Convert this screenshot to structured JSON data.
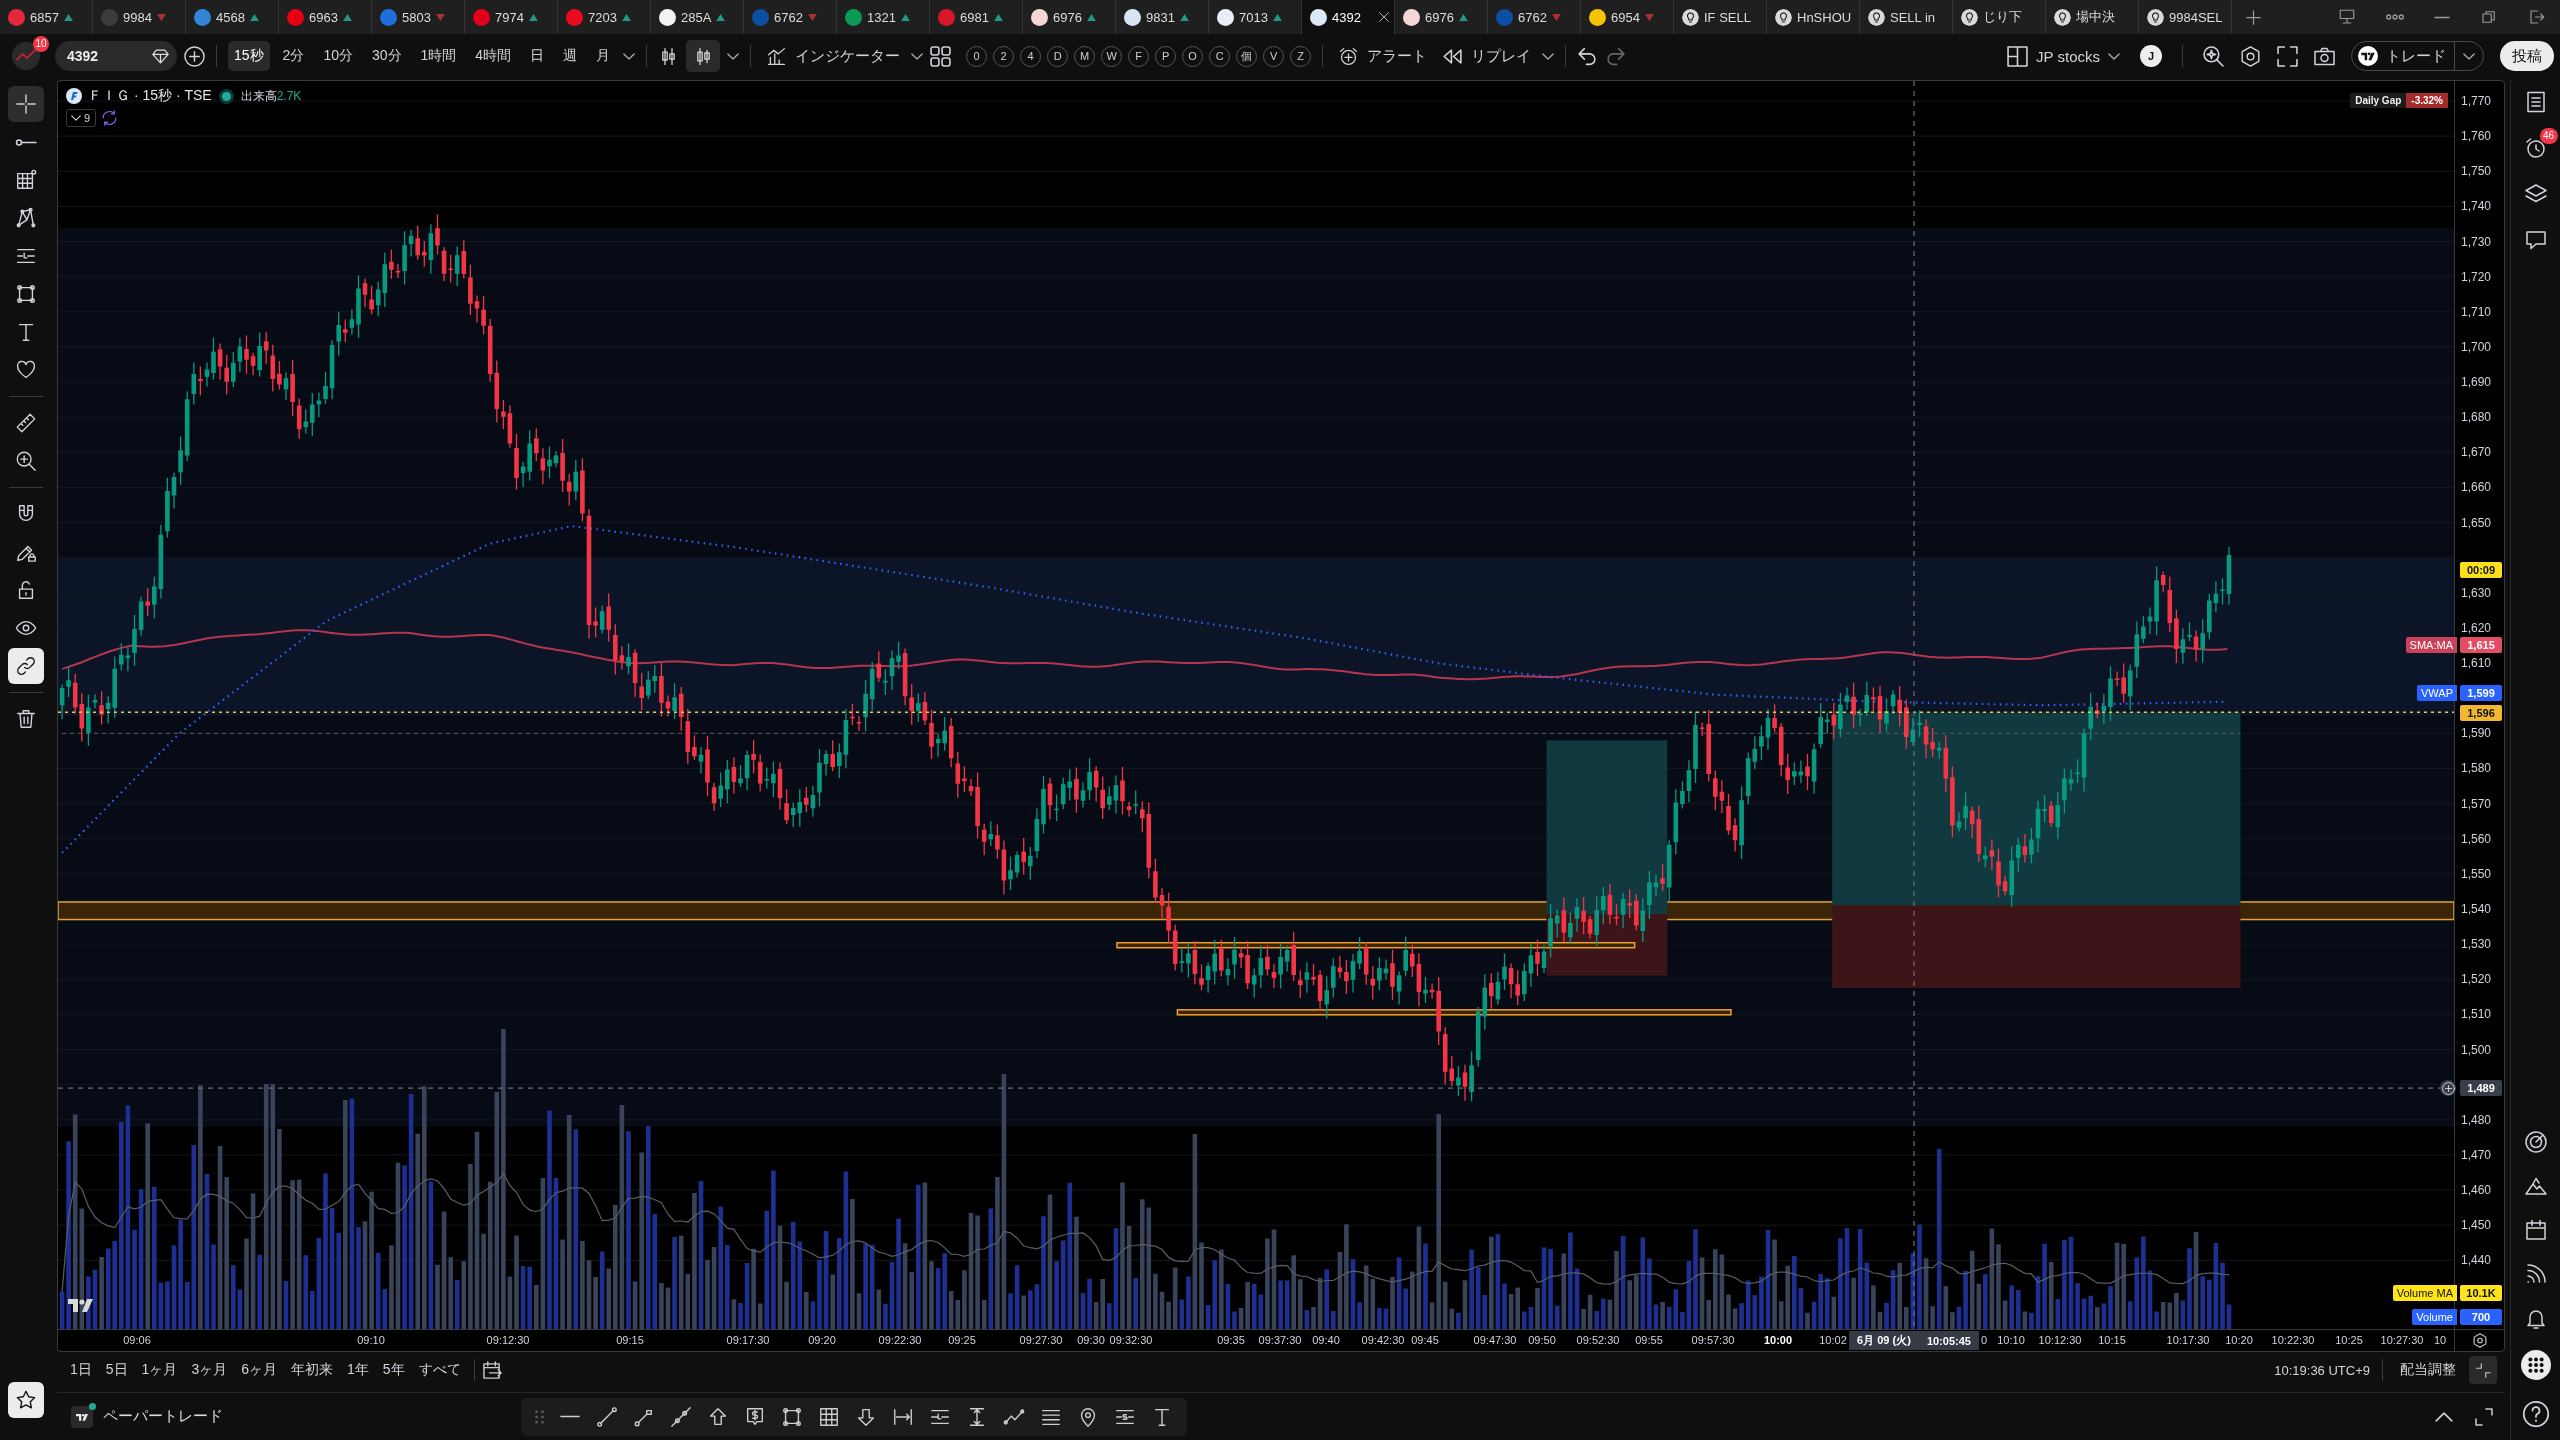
{
  "tabs": [
    {
      "kind": "symbol",
      "label": "6857",
      "color": "#e3283c",
      "rising": true,
      "selected": false
    },
    {
      "kind": "symbol",
      "label": "9984",
      "color": "#3c3c3c",
      "rising": false,
      "selected": false
    },
    {
      "kind": "symbol",
      "label": "4568",
      "color": "#2f86d6",
      "rising": true,
      "selected": false
    },
    {
      "kind": "symbol",
      "label": "6963",
      "color": "#e60012",
      "rising": true,
      "selected": false
    },
    {
      "kind": "symbol",
      "label": "5803",
      "color": "#1e6fd9",
      "rising": false,
      "selected": false
    },
    {
      "kind": "symbol",
      "label": "7974",
      "color": "#e4001b",
      "rising": true,
      "selected": false
    },
    {
      "kind": "symbol",
      "label": "7203",
      "color": "#eb0a1e",
      "rising": true,
      "selected": false
    },
    {
      "kind": "symbol",
      "label": "285A",
      "color": "#f2f2f2",
      "rising": true,
      "selected": false
    },
    {
      "kind": "symbol",
      "label": "6762",
      "color": "#0b4ea2",
      "rising": false,
      "selected": false
    },
    {
      "kind": "symbol",
      "label": "1321",
      "color": "#0a9a55",
      "rising": true,
      "selected": false
    },
    {
      "kind": "symbol",
      "label": "6981",
      "color": "#d7182a",
      "rising": true,
      "selected": false
    },
    {
      "kind": "symbol",
      "label": "6976",
      "color": "#f4d6d8",
      "rising": true,
      "selected": false
    },
    {
      "kind": "symbol",
      "label": "9831",
      "color": "#d8e4f4",
      "rising": true,
      "selected": false
    },
    {
      "kind": "symbol",
      "label": "7013",
      "color": "#e8eef8",
      "rising": true,
      "selected": false
    },
    {
      "kind": "symbol",
      "label": "4392",
      "color": "#dce8f6",
      "selected": true
    },
    {
      "kind": "symbol",
      "label": "6976",
      "color": "#f4d6d8",
      "rising": true,
      "selected": false
    },
    {
      "kind": "symbol",
      "label": "6762",
      "color": "#0b4ea2",
      "rising": false,
      "selected": false
    },
    {
      "kind": "symbol",
      "label": "6954",
      "color": "#f5c400",
      "rising": false,
      "selected": false
    },
    {
      "kind": "idea",
      "label": "IF SELL",
      "selected": false
    },
    {
      "kind": "idea",
      "label": "HnSHOU",
      "selected": false
    },
    {
      "kind": "idea",
      "label": "SELL in",
      "selected": false
    },
    {
      "kind": "idea",
      "label": "じり下",
      "selected": false
    },
    {
      "kind": "idea",
      "label": "場中決",
      "selected": false
    },
    {
      "kind": "idea",
      "label": "9984SEL",
      "selected": false
    }
  ],
  "toolbar": {
    "notifications": "10",
    "symbol": "4392",
    "intervals": [
      {
        "label": "15秒",
        "selected": true
      },
      {
        "label": "2分",
        "selected": false
      },
      {
        "label": "10分",
        "selected": false
      },
      {
        "label": "30分",
        "selected": false
      },
      {
        "label": "1時間",
        "selected": false
      },
      {
        "label": "4時間",
        "selected": false
      },
      {
        "label": "日",
        "selected": false
      },
      {
        "label": "週",
        "selected": false
      },
      {
        "label": "月",
        "selected": false
      }
    ],
    "indicators": "インジケーター",
    "quick_buttons": [
      "0",
      "2",
      "4",
      "D",
      "M",
      "W",
      "F",
      "P",
      "O",
      "C",
      "個",
      "V",
      "Z"
    ],
    "alert": "アラート",
    "replay": "リプレイ",
    "layout": "JP stocks",
    "user_initial": "J",
    "trade": "トレード",
    "publish": "投稿"
  },
  "left_toolbar": {
    "tools": [
      {
        "selected": true
      },
      {
        "selected": false
      },
      {
        "selected": false
      },
      {
        "selected": false
      },
      {
        "selected": false
      },
      {
        "selected": false
      },
      {
        "selected": false
      },
      {
        "selected": false
      },
      {
        "selected": false
      },
      {
        "selected": false
      }
    ],
    "toggles": [
      {
        "on": false
      },
      {
        "on": false
      },
      {
        "on": false
      },
      {
        "on": false
      },
      {
        "on": true
      }
    ]
  },
  "chart": {
    "title": "ＦＩＧ · 15秒 · TSE",
    "volume_label": "出来高",
    "volume_value": "2.7K",
    "indicator_count": "9",
    "daily_gap": {
      "label": "Daily Gap",
      "value": "-3.32%"
    },
    "price_labels": [
      "1,770",
      "1,760",
      "1,750",
      "1,740",
      "1,730",
      "1,720",
      "1,710",
      "1,700",
      "1,690",
      "1,680",
      "1,670",
      "1,660",
      "1,650",
      "1,630",
      "1,620",
      "1,610",
      "1,590",
      "1,580",
      "1,570",
      "1,560",
      "1,550",
      "1,540",
      "1,530",
      "1,520",
      "1,510",
      "1,500",
      "1,480",
      "1,470",
      "1,460",
      "1,450",
      "1,440"
    ],
    "price_badges": [
      {
        "kind": "countdown",
        "value": "00:09"
      },
      {
        "kind": "study",
        "label": "SMA:MA",
        "value": "1,615"
      },
      {
        "kind": "vwap",
        "label": "VWAP",
        "value": "1,599"
      },
      {
        "kind": "last_price",
        "value": "1,596"
      },
      {
        "kind": "crosshair",
        "value": "1,489"
      },
      {
        "kind": "volume_ma",
        "label": "Volume MA",
        "value": "10.1K"
      },
      {
        "kind": "volume",
        "label": "Volume",
        "value": "700"
      }
    ],
    "time_labels": [
      {
        "text": "09:06",
        "major": false
      },
      {
        "text": "09:10",
        "major": false
      },
      {
        "text": "09:12:30",
        "major": false
      },
      {
        "text": "09:15",
        "major": false
      },
      {
        "text": "09:17:30",
        "major": false
      },
      {
        "text": "09:20",
        "major": false
      },
      {
        "text": "09:22:30",
        "major": false
      },
      {
        "text": "09:25",
        "major": false
      },
      {
        "text": "09:27:30",
        "major": false
      },
      {
        "text": "09:30",
        "major": false
      },
      {
        "text": "09:32:30",
        "major": false
      },
      {
        "text": "09:35",
        "major": false
      },
      {
        "text": "09:37:30",
        "major": false
      },
      {
        "text": "09:40",
        "major": false
      },
      {
        "text": "09:42:30",
        "major": false
      },
      {
        "text": "09:45",
        "major": false
      },
      {
        "text": "09:47:30",
        "major": false
      },
      {
        "text": "09:50",
        "major": false
      },
      {
        "text": "09:52:30",
        "major": false
      },
      {
        "text": "09:55",
        "major": false
      },
      {
        "text": "09:57:30",
        "major": false
      },
      {
        "text": "10:00",
        "major": true
      },
      {
        "text": "10:02",
        "major": false
      },
      {
        "text": "0",
        "major": false
      },
      {
        "text": "10:10",
        "major": false
      },
      {
        "text": "10:12:30",
        "major": false
      },
      {
        "text": "10:15",
        "major": false
      },
      {
        "text": "10:17:30",
        "major": false
      },
      {
        "text": "10:20",
        "major": false
      },
      {
        "text": "10:22:30",
        "major": false
      },
      {
        "text": "10:25",
        "major": false
      },
      {
        "text": "10:27:30",
        "major": false
      },
      {
        "text": "10",
        "major": false
      }
    ],
    "crosshair_time": {
      "date": "6月 09 (火)",
      "time": "10:05:45"
    }
  },
  "range_bar": {
    "ranges": [
      "1日",
      "5日",
      "1ヶ月",
      "3ヶ月",
      "6ヶ月",
      "年初来",
      "1年",
      "5年",
      "すべて"
    ],
    "clock": "10:19:36 UTC+9",
    "adjustment": "配当調整"
  },
  "bottom_panel": {
    "title": "ペーパートレード"
  },
  "right_sidebar": {
    "alerts_badge": "46"
  }
}
